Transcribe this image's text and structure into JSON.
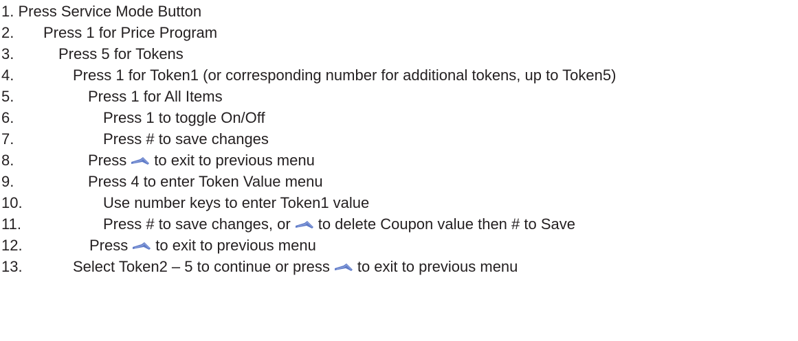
{
  "document": {
    "steps": [
      {
        "number": "1.",
        "text": "Press Service Mode Button"
      },
      {
        "number": "2.",
        "text": "Press 1 for Price Program"
      },
      {
        "number": "3.",
        "text": "Press 5 for Tokens"
      },
      {
        "number": "4.",
        "text": "Press 1 for Token1 (or corresponding number for additional tokens, up to Token5)"
      },
      {
        "number": "5.",
        "text": "Press 1 for All Items"
      },
      {
        "number": "6.",
        "text": "Press 1 to toggle On/Off"
      },
      {
        "number": "7.",
        "text": "Press # to save changes"
      },
      {
        "number": "8.",
        "text_before": "Press",
        "text_after": "to exit to previous menu",
        "icon": "delete-arrow-icon"
      },
      {
        "number": "9.",
        "text": "Press 4 to enter Token Value menu"
      },
      {
        "number": "10.",
        "text": "Use number keys to enter Token1 value"
      },
      {
        "number": "11.",
        "text_before": "Press # to save changes, or",
        "text_after": "to delete Coupon value then # to Save",
        "icon": "delete-arrow-icon"
      },
      {
        "number": "12.",
        "text_before": "Press",
        "text_after": "to exit to previous menu",
        "icon": "delete-arrow-icon"
      },
      {
        "number": "13.",
        "text_before": "Select Token2 – 5 to continue or press",
        "text_after": "to exit to previous menu",
        "icon": "delete-arrow-icon"
      }
    ],
    "icon_color": "#5f7bc8"
  }
}
